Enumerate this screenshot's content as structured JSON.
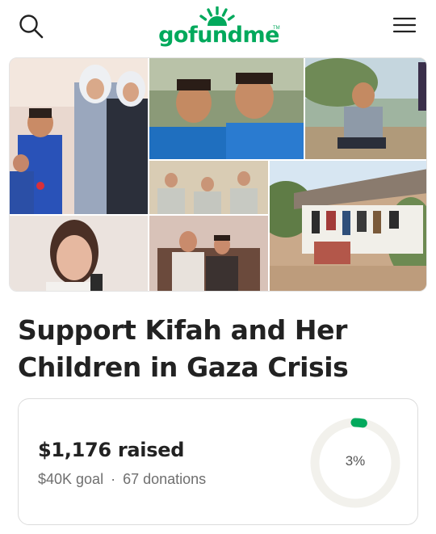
{
  "header": {
    "brand": "gofundme",
    "brand_mark": "TM",
    "icons": {
      "search": "search-icon",
      "menu": "hamburger-menu-icon",
      "logo_sun": "sunburst-logo-icon"
    },
    "brand_color": "#02a95c"
  },
  "gallery": {
    "photos": [
      {
        "name": "photo-girls-and-boys-at-home"
      },
      {
        "name": "photo-two-boys-in-blue"
      },
      {
        "name": "photo-boy-sitting-outdoors"
      },
      {
        "name": "photo-three-children-indoors"
      },
      {
        "name": "photo-tent-with-laundry"
      },
      {
        "name": "photo-girl-portrait"
      },
      {
        "name": "photo-mother-and-son"
      }
    ]
  },
  "campaign": {
    "title_line1": "Support Kifah and Her",
    "title_line2": "Children in Gaza Crisis"
  },
  "stats": {
    "raised": "$1,176 raised",
    "goal": "$40K goal",
    "separator": "·",
    "donations": "67 donations",
    "progress_label": "3%",
    "progress_fraction": 0.03,
    "ring_color": "#02a95c",
    "track_color": "#f2f1ec"
  }
}
